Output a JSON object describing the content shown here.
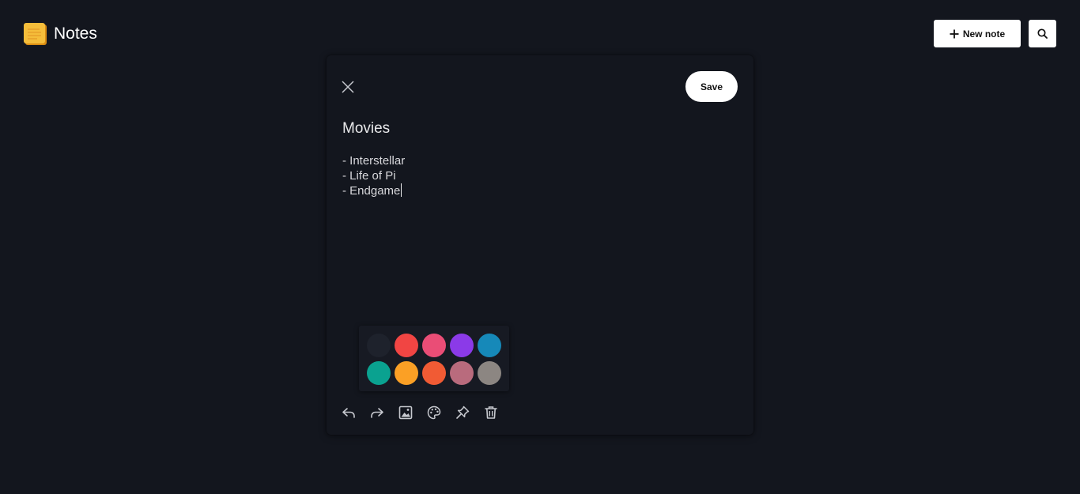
{
  "header": {
    "app_title": "Notes",
    "logo_icon": "sticky-note-icon",
    "new_note_label": "New note",
    "new_note_icon": "plus-icon",
    "search_icon": "search-icon"
  },
  "editor": {
    "close_icon": "close-icon",
    "save_label": "Save",
    "note_title": "Movies",
    "note_lines": [
      "- Interstellar",
      "- Life of Pi",
      "- Endgame"
    ]
  },
  "palette": {
    "colors": [
      "#1e222c",
      "#f14543",
      "#ea4d76",
      "#8b3ae8",
      "#1689b9",
      "#0aa290",
      "#fba025",
      "#f15b34",
      "#b96b7d",
      "#8c8682"
    ]
  },
  "toolbar": {
    "icons": [
      "undo-icon",
      "redo-icon",
      "image-icon",
      "palette-icon",
      "pin-icon",
      "trash-icon"
    ]
  },
  "colors": {
    "background": "#13161e",
    "button_bg": "#ffffff"
  }
}
